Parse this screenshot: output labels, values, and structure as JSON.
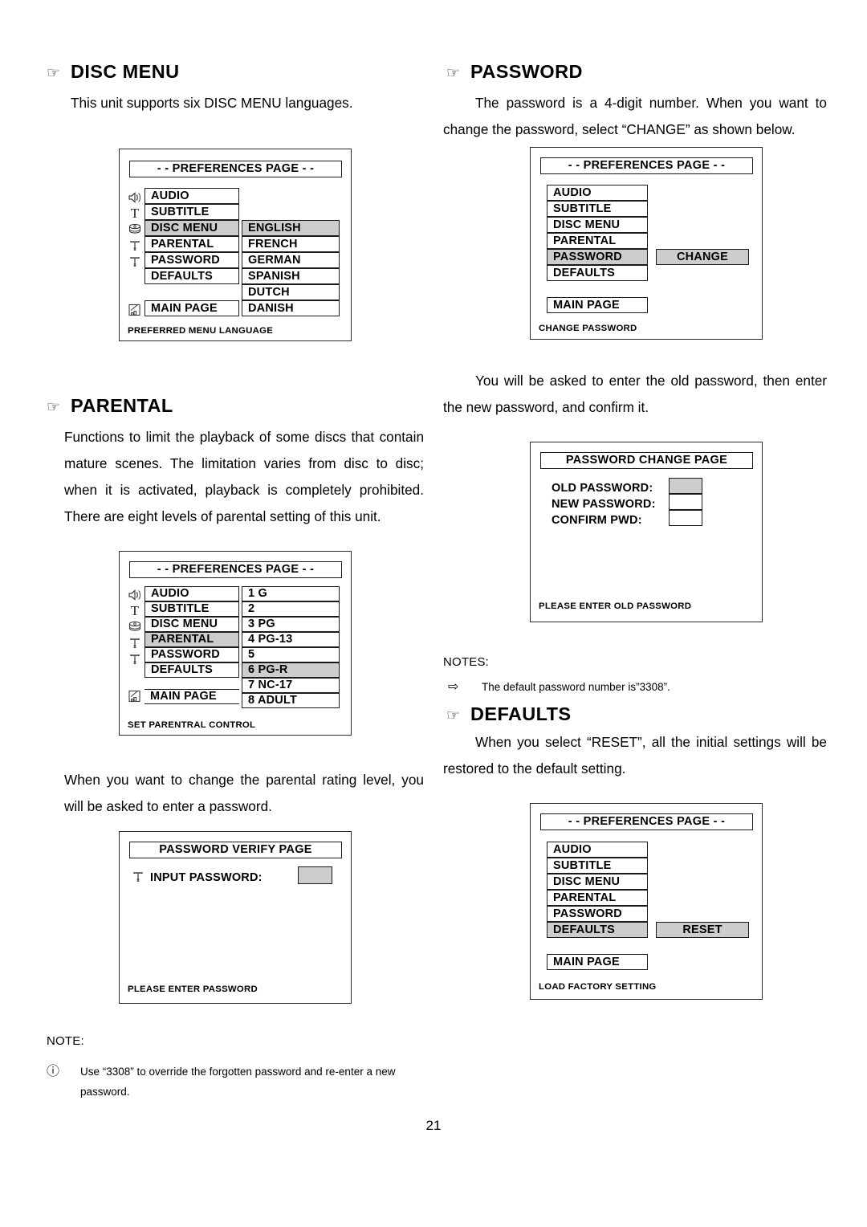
{
  "page": {
    "number": "21"
  },
  "sections": {
    "disc_menu": {
      "bullet": "☞",
      "title": "DISC MENU",
      "paragraph": "This unit supports six DISC MENU languages."
    },
    "parental": {
      "bullet": "☞",
      "title": "PARENTAL",
      "paragraph": "Functions to limit the playback of some discs that contain mature scenes. The limitation varies from disc to disc; when it is activated, playback is completely prohibited. There are eight levels of parental setting of this unit.",
      "paragraph2": "When you want to change the parental rating level, you will be asked to enter a password."
    },
    "password": {
      "bullet": "☞",
      "title": "PASSWORD",
      "paragraph": "The password is a 4-digit number. When you want to change the password, select “CHANGE” as shown below.",
      "paragraph2": "You will be asked to enter the old password, then enter the new password, and confirm it."
    },
    "defaults": {
      "bullet": "☞",
      "title": "DEFAULTS",
      "paragraph": "When you select “RESET”, all the initial settings will be restored to the default setting."
    }
  },
  "notes": {
    "right": {
      "label": "NOTES:",
      "bullet": "⇨",
      "text": "The default password number is”3308”."
    },
    "bottom": {
      "label": "NOTE:",
      "bullet": "ⓘ",
      "text": "Use “3308” to override the forgotten password and re-enter a new password."
    }
  },
  "osd_disc_menu": {
    "title": "- - PREFERENCES PAGE - -",
    "menu": [
      "AUDIO",
      "SUBTITLE",
      "DISC MENU",
      "PARENTAL",
      "PASSWORD",
      "DEFAULTS"
    ],
    "selected_menu": "DISC MENU",
    "main_page": "MAIN PAGE",
    "options": [
      "ENGLISH",
      "FRENCH",
      "GERMAN",
      "SPANISH",
      "DUTCH",
      "DANISH"
    ],
    "selected_option": "ENGLISH",
    "status": "PREFERRED MENU LANGUAGE",
    "icons": [
      "speaker-icon",
      "subtitle-t-icon",
      "disc-stack-icon",
      "key-icon",
      "key-icon",
      "main-page-icon"
    ]
  },
  "osd_password": {
    "title": "- - PREFERENCES PAGE - -",
    "menu": [
      "AUDIO",
      "SUBTITLE",
      "DISC MENU",
      "PARENTAL",
      "PASSWORD",
      "DEFAULTS"
    ],
    "selected_menu": "PASSWORD",
    "main_page": "MAIN PAGE",
    "option": "CHANGE",
    "status": "CHANGE PASSWORD"
  },
  "osd_parental": {
    "title": "- - PREFERENCES PAGE - -",
    "menu": [
      "AUDIO",
      "SUBTITLE",
      "DISC MENU",
      "PARENTAL",
      "PASSWORD",
      "DEFAULTS"
    ],
    "selected_menu": "PARENTAL",
    "main_page": "MAIN PAGE",
    "levels": [
      "1  G",
      "2",
      "3  PG",
      "4  PG-13",
      "5",
      "6  PG-R",
      "7  NC-17",
      "8  ADULT"
    ],
    "selected_level": "6  PG-R",
    "status": "SET PARENTRAL CONTROL",
    "icons": [
      "speaker-icon",
      "subtitle-t-icon",
      "disc-stack-icon",
      "key-icon",
      "key-icon",
      "main-page-icon"
    ]
  },
  "osd_password_verify": {
    "title": "PASSWORD VERIFY PAGE",
    "field_label": "INPUT PASSWORD:",
    "field_value": "",
    "status": "PLEASE ENTER PASSWORD",
    "icon": "key-icon"
  },
  "osd_password_change": {
    "title": "PASSWORD CHANGE PAGE",
    "fields": [
      {
        "label": "OLD PASSWORD:",
        "value": "",
        "active": true
      },
      {
        "label": "NEW PASSWORD:",
        "value": "",
        "active": false
      },
      {
        "label": "CONFIRM PWD:",
        "value": "",
        "active": false
      }
    ],
    "status": "PLEASE ENTER OLD PASSWORD"
  },
  "osd_defaults": {
    "title": "- - PREFERENCES PAGE - -",
    "menu": [
      "AUDIO",
      "SUBTITLE",
      "DISC MENU",
      "PARENTAL",
      "PASSWORD",
      "DEFAULTS"
    ],
    "selected_menu": "DEFAULTS",
    "main_page": "MAIN PAGE",
    "option": "RESET",
    "status": "LOAD FACTORY SETTING"
  },
  "colors": {
    "highlight": "#cdcdcd",
    "shadow": "#808080",
    "border": "#1a1a1a"
  }
}
